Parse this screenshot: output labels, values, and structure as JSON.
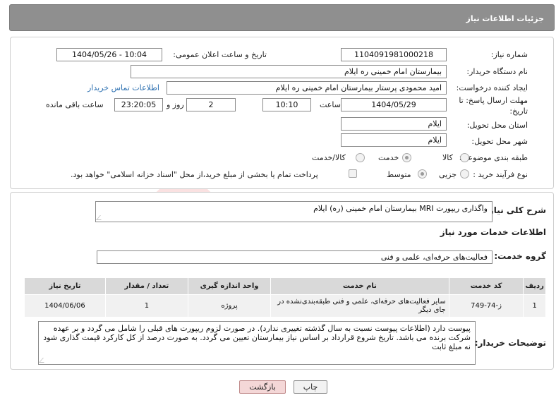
{
  "header": {
    "title": "جزئیات اطلاعات نیاز"
  },
  "form": {
    "need_number_label": "شماره نیاز:",
    "need_number": "1104091981000218",
    "announce_label": "تاریخ و ساعت اعلان عمومی:",
    "announce_value": "1404/05/26 - 10:04",
    "buyer_org_label": "نام دستگاه خریدار:",
    "buyer_org": "بیمارستان امام خمینی  ره  ایلام",
    "creator_label": "ایجاد کننده درخواست:",
    "creator": "امید محمودی پرستار بیمارستان امام خمینی  ره  ایلام",
    "contact_link": "اطلاعات تماس خریدار",
    "deadline_label_line1": "مهلت ارسال پاسخ: تا",
    "deadline_label_line2": "تاریخ:",
    "deadline_date": "1404/05/29",
    "time_label": "ساعت",
    "deadline_time": "10:10",
    "days_value": "2",
    "days_label": "روز و",
    "remaining_time": "23:20:05",
    "remaining_label": "ساعت باقی مانده",
    "province_label": "استان محل تحویل:",
    "province": "ایلام",
    "city_label": "شهر محل تحویل:",
    "city": "ایلام",
    "category_label": "طبقه بندی موضوعی:",
    "category_options": [
      "کالا",
      "خدمت",
      "کالا/خدمت"
    ],
    "category_selected": "خدمت",
    "purchase_type_label": "نوع فرآیند خرید :",
    "purchase_options": [
      "جزیی",
      "متوسط"
    ],
    "purchase_selected": "جزیی",
    "payment_note": "پرداخت تمام یا بخشی از مبلغ خرید،از محل \"اسناد خزانه اسلامی\" خواهد بود."
  },
  "details": {
    "summary_label": "شرح کلی نیاز:",
    "summary": "واگذاری ریپورت MRI بیمارستان امام خمینی (ره) ایلام",
    "services_title": "اطلاعات خدمات مورد نیاز",
    "service_group_label": "گروه خدمت:",
    "service_group": "فعالیت‌های حرفه‌ای، علمی و فنی",
    "table": {
      "headers": [
        "ردیف",
        "کد خدمت",
        "نام خدمت",
        "واحد اندازه گیری",
        "تعداد / مقدار",
        "تاریخ نیاز"
      ],
      "rows": [
        [
          "1",
          "ز-74-749",
          "سایر فعالیت‌های حرفه‌ای، علمی و فنی طبقه‌بندی‌نشده در جای دیگر",
          "پروژه",
          "1",
          "1404/06/06"
        ]
      ]
    },
    "buyer_notes_label": "توضیحات خریدار:",
    "buyer_notes": "پیوست دارد (اطلاعات پیوست نسبت به سال گذشته تغییری ندارد). در صورت لزوم ریپورت های قبلی را شامل می گردد و بر عهده شرکت برنده می باشد. تاریخ شروع قرارداد بر اساس نیاز بیمارستان تعیین می گردد. به صورت درصد از کل کارکرد قیمت گذاری شود نه مبلغ ثابت"
  },
  "buttons": {
    "print": "چاپ",
    "back": "بازگشت"
  },
  "watermark": {
    "text": "AriaTender.neT"
  }
}
